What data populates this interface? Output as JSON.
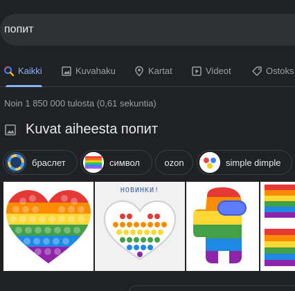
{
  "search": {
    "query": "попит"
  },
  "tabs": [
    {
      "label": "Kaikki",
      "icon": "search-icon"
    },
    {
      "label": "Kuvahaku",
      "icon": "image-icon"
    },
    {
      "label": "Kartat",
      "icon": "map-pin-icon"
    },
    {
      "label": "Videot",
      "icon": "video-icon"
    },
    {
      "label": "Ostoks",
      "icon": "tag-icon"
    }
  ],
  "result_stats": "Noin 1 850 000 tulosta (0,61 sekuntia)",
  "images_section": {
    "title": "Kuvat aiheesta попит",
    "chips": [
      {
        "label": "браслет"
      },
      {
        "label": "символ"
      },
      {
        "label": "ozon"
      },
      {
        "label": "simple dimple"
      }
    ],
    "image_tiles": [
      {
        "alt": "rainbow heart pop it"
      },
      {
        "caption": "НОВИНКИ!"
      },
      {
        "alt": "rainbow crewmate pop it"
      },
      {
        "alt": "rainbow square pop it"
      }
    ]
  },
  "colors": {
    "background": "#202124",
    "search_bg": "#303134",
    "accent": "#8ab4f8",
    "muted_text": "#9aa0a6"
  }
}
